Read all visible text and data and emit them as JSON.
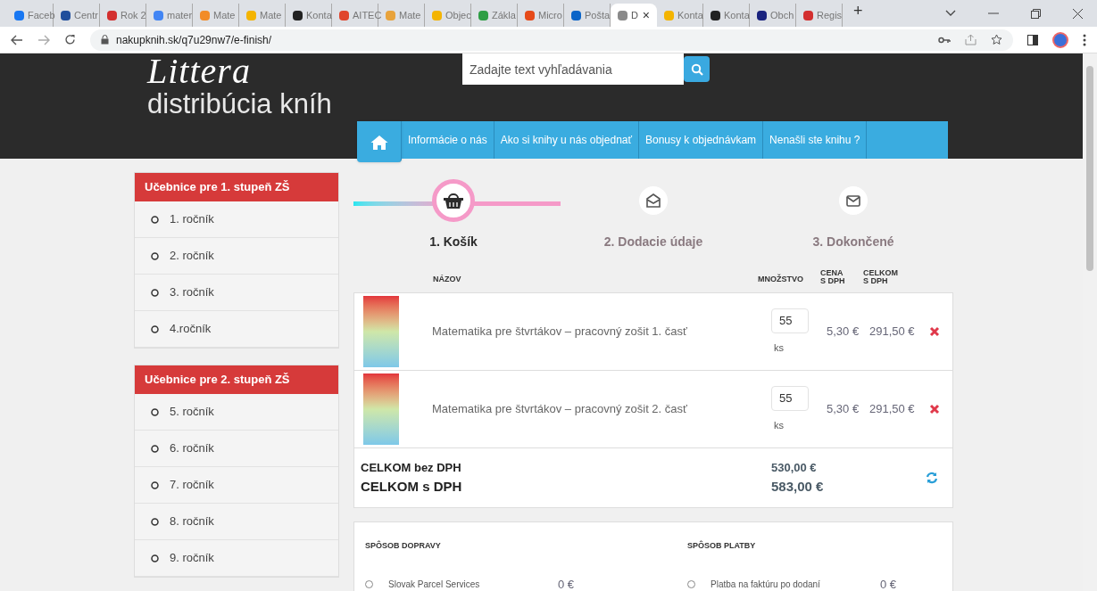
{
  "browser": {
    "tabs": [
      {
        "title": "Faceb",
        "selected": false,
        "color": "#1877f2"
      },
      {
        "title": "Centr",
        "selected": false,
        "color": "#1f4e9c"
      },
      {
        "title": "Rok 2",
        "selected": false,
        "color": "#d32f2f"
      },
      {
        "title": "mater",
        "selected": false,
        "color": "#4285f4"
      },
      {
        "title": "Mate",
        "selected": false,
        "color": "#f28c28"
      },
      {
        "title": "Mate",
        "selected": false,
        "color": "#f4b400"
      },
      {
        "title": "Konta",
        "selected": false,
        "color": "#222222"
      },
      {
        "title": "AITEC",
        "selected": false,
        "color": "#e0452c"
      },
      {
        "title": "Mate",
        "selected": false,
        "color": "#e8a33c"
      },
      {
        "title": "Objec",
        "selected": false,
        "color": "#f4b400"
      },
      {
        "title": "Zákla",
        "selected": false,
        "color": "#2e9e44"
      },
      {
        "title": "Micro",
        "selected": false,
        "color": "#e64a19"
      },
      {
        "title": "Pošta",
        "selected": false,
        "color": "#0a64c8"
      },
      {
        "title": "D",
        "selected": true,
        "color": "#8a8a8a"
      },
      {
        "title": "Konta",
        "selected": false,
        "color": "#f4b400"
      },
      {
        "title": "Konta",
        "selected": false,
        "color": "#222222"
      },
      {
        "title": "Obch",
        "selected": false,
        "color": "#1a237e"
      },
      {
        "title": "Regis",
        "selected": false,
        "color": "#d32f2f"
      }
    ],
    "close_tab": "×",
    "new_tab": "+",
    "address": "nakupknih.sk/q7u29nw7/e-finish/"
  },
  "header": {
    "logo": "Littera",
    "tagline": "distribúcia kníh",
    "search": {
      "placeholder": "Zadajte text vyhľadávania"
    },
    "nav": [
      "Informácie o nás",
      "Ako si knihy u nás objednať",
      "Bonusy k objednávkam",
      "Nenašli ste knihu ?"
    ]
  },
  "sidebar": [
    {
      "title": "Učebnice pre 1. stupeň ZŠ",
      "items": [
        "1. ročník",
        "2. ročník",
        "3. ročník",
        "4.ročník"
      ]
    },
    {
      "title": "Učebnice pre 2. stupeň ZŠ",
      "items": [
        "5. ročník",
        "6. ročník",
        "7. ročník",
        "8. ročník",
        "9. ročník"
      ]
    }
  ],
  "steps": [
    {
      "label": "1. Košík",
      "selected": true,
      "kind": "basket"
    },
    {
      "label": "2. Dodacie údaje",
      "selected": false,
      "kind": "envelope-open"
    },
    {
      "label": "3. Dokončené",
      "selected": false,
      "kind": "envelope"
    }
  ],
  "cart": {
    "columns": [
      "NÁZOV",
      "MNOŽSTVO",
      "CENA S DPH",
      "CELKOM S DPH"
    ],
    "rows": [
      {
        "title": "Matematika pre štvrtákov – pracovný zošit 1. časť",
        "quantity": "55",
        "unit": "ks",
        "price": "5,30 €",
        "total": "291,50 €"
      },
      {
        "title": "Matematika pre štvrtákov – pracovný zošit 2. časť",
        "quantity": "55",
        "unit": "ks",
        "price": "5,30 €",
        "total": "291,50 €"
      }
    ],
    "totals": [
      {
        "label": "CELKOM bez DPH",
        "value": "530,00 €"
      },
      {
        "label": "CELKOM s DPH",
        "value": "583,00 €"
      }
    ]
  },
  "options": [
    {
      "title": "SPÔSOB DOPRAVY",
      "items": [
        {
          "label": "Slovak Parcel Services",
          "price": "0 €",
          "selected": false
        }
      ]
    },
    {
      "title": "SPÔSOB PLATBY",
      "items": [
        {
          "label": "Platba na faktúru po dodaní",
          "price": "0 €",
          "selected": false
        }
      ]
    }
  ]
}
